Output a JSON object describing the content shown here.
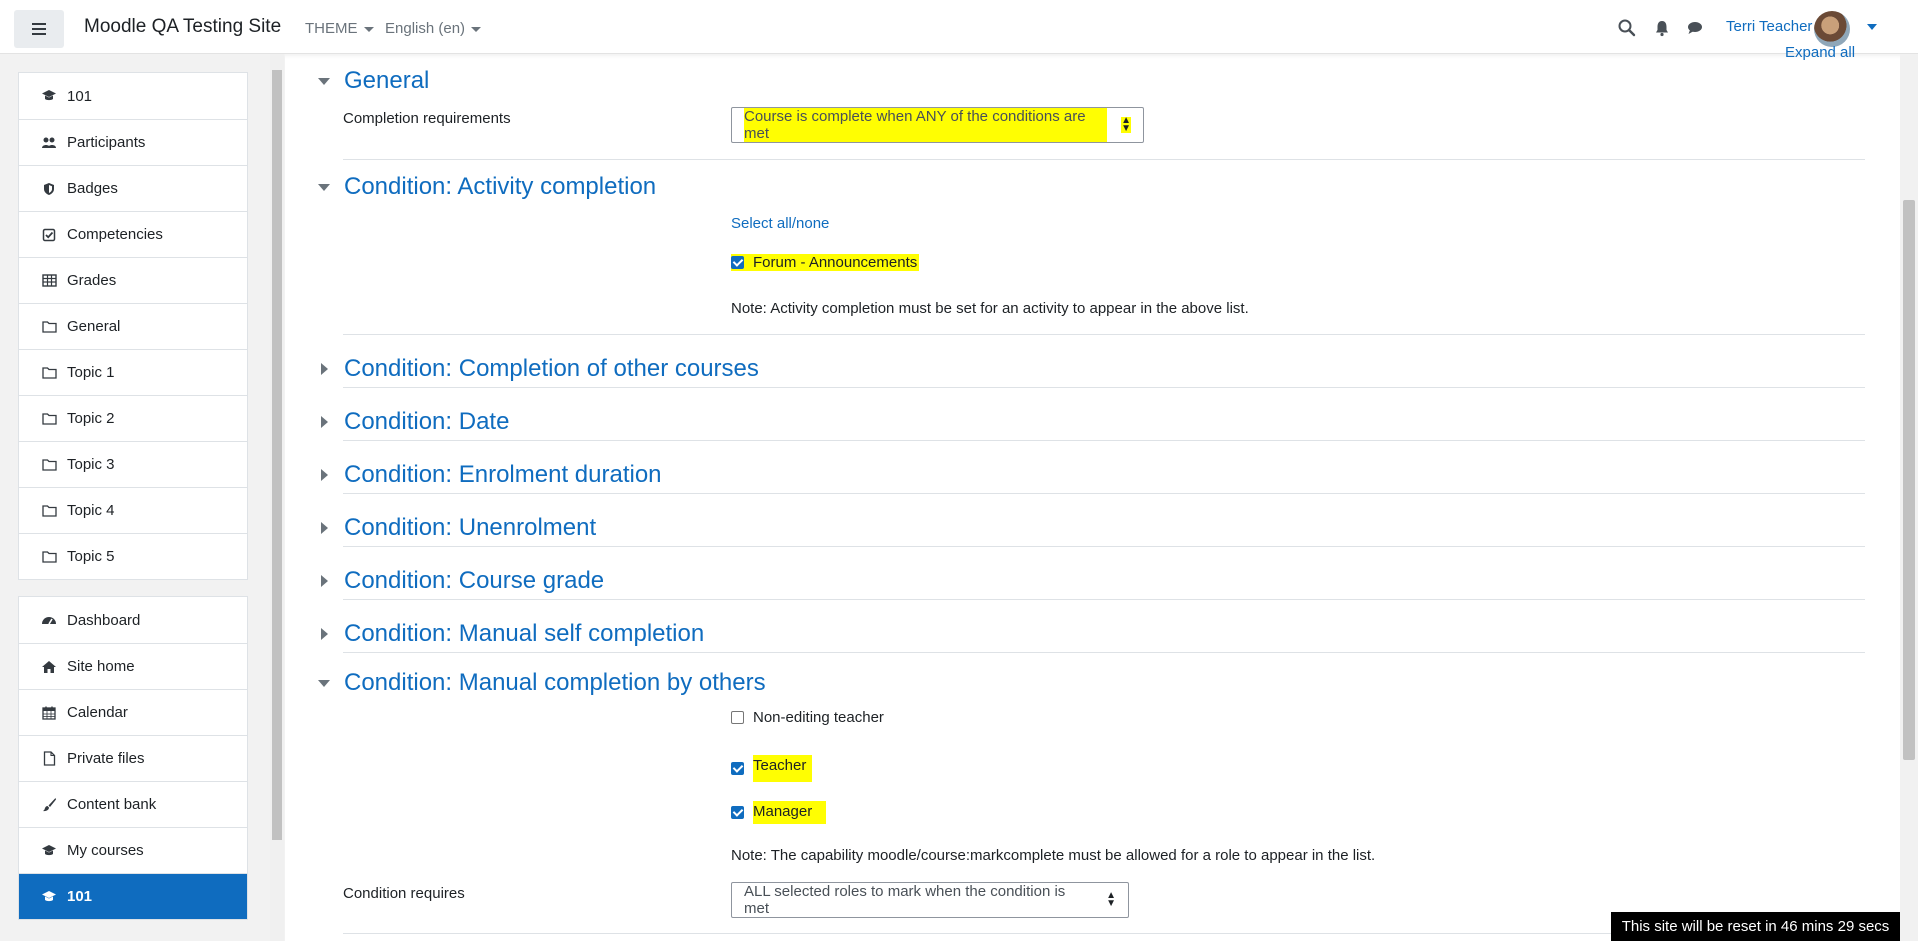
{
  "navbar": {
    "site_name": "Moodle QA Testing Site",
    "theme_label": "THEME",
    "language_label": "English (en)",
    "user_name": "Terri Teacher"
  },
  "drawer": {
    "course_items": [
      {
        "label": "101",
        "icon": "graduation-cap-icon"
      },
      {
        "label": "Participants",
        "icon": "users-icon"
      },
      {
        "label": "Badges",
        "icon": "shield-icon"
      },
      {
        "label": "Competencies",
        "icon": "check-square-icon"
      },
      {
        "label": "Grades",
        "icon": "table-icon"
      },
      {
        "label": "General",
        "icon": "folder-icon"
      },
      {
        "label": "Topic 1",
        "icon": "folder-icon"
      },
      {
        "label": "Topic 2",
        "icon": "folder-icon"
      },
      {
        "label": "Topic 3",
        "icon": "folder-icon"
      },
      {
        "label": "Topic 4",
        "icon": "folder-icon"
      },
      {
        "label": "Topic 5",
        "icon": "folder-icon"
      }
    ],
    "site_items": [
      {
        "label": "Dashboard",
        "icon": "dashboard-icon"
      },
      {
        "label": "Site home",
        "icon": "home-icon"
      },
      {
        "label": "Calendar",
        "icon": "calendar-icon"
      },
      {
        "label": "Private files",
        "icon": "file-icon"
      },
      {
        "label": "Content bank",
        "icon": "paint-brush-icon"
      },
      {
        "label": "My courses",
        "icon": "graduation-cap-icon"
      },
      {
        "label": "101",
        "icon": "graduation-cap-icon",
        "active": true
      }
    ]
  },
  "main": {
    "expand_all": "Expand all",
    "general": {
      "title": "General",
      "completion_requirements_label": "Completion requirements",
      "completion_requirements_value": "Course is complete when ANY of the conditions are met"
    },
    "activity": {
      "title": "Condition: Activity completion",
      "select_all": "Select all/none",
      "option": "Forum - Announcements",
      "option_checked": true,
      "note": "Note: Activity completion must be set for an activity to appear in the above list."
    },
    "collapsed_sections": [
      "Condition: Completion of other courses",
      "Condition: Date",
      "Condition: Enrolment duration",
      "Condition: Unenrolment",
      "Condition: Course grade",
      "Condition: Manual self completion"
    ],
    "manual_others": {
      "title": "Condition: Manual completion by others",
      "roles": [
        {
          "label": "Non-editing teacher",
          "checked": false
        },
        {
          "label": "Teacher",
          "checked": true
        },
        {
          "label": "Manager",
          "checked": true
        }
      ],
      "note": "Note: The capability moodle/course:markcomplete must be allowed for a role to appear in the list.",
      "condition_requires_label": "Condition requires",
      "condition_requires_value": "ALL selected roles to mark when the condition is met"
    }
  },
  "footer": {
    "reset_timer": "This site will be reset in 46 mins 29 secs"
  },
  "colors": {
    "link": "#0f6cbf",
    "highlight": "#fffe02",
    "active_nav": "#0f6cbf"
  }
}
